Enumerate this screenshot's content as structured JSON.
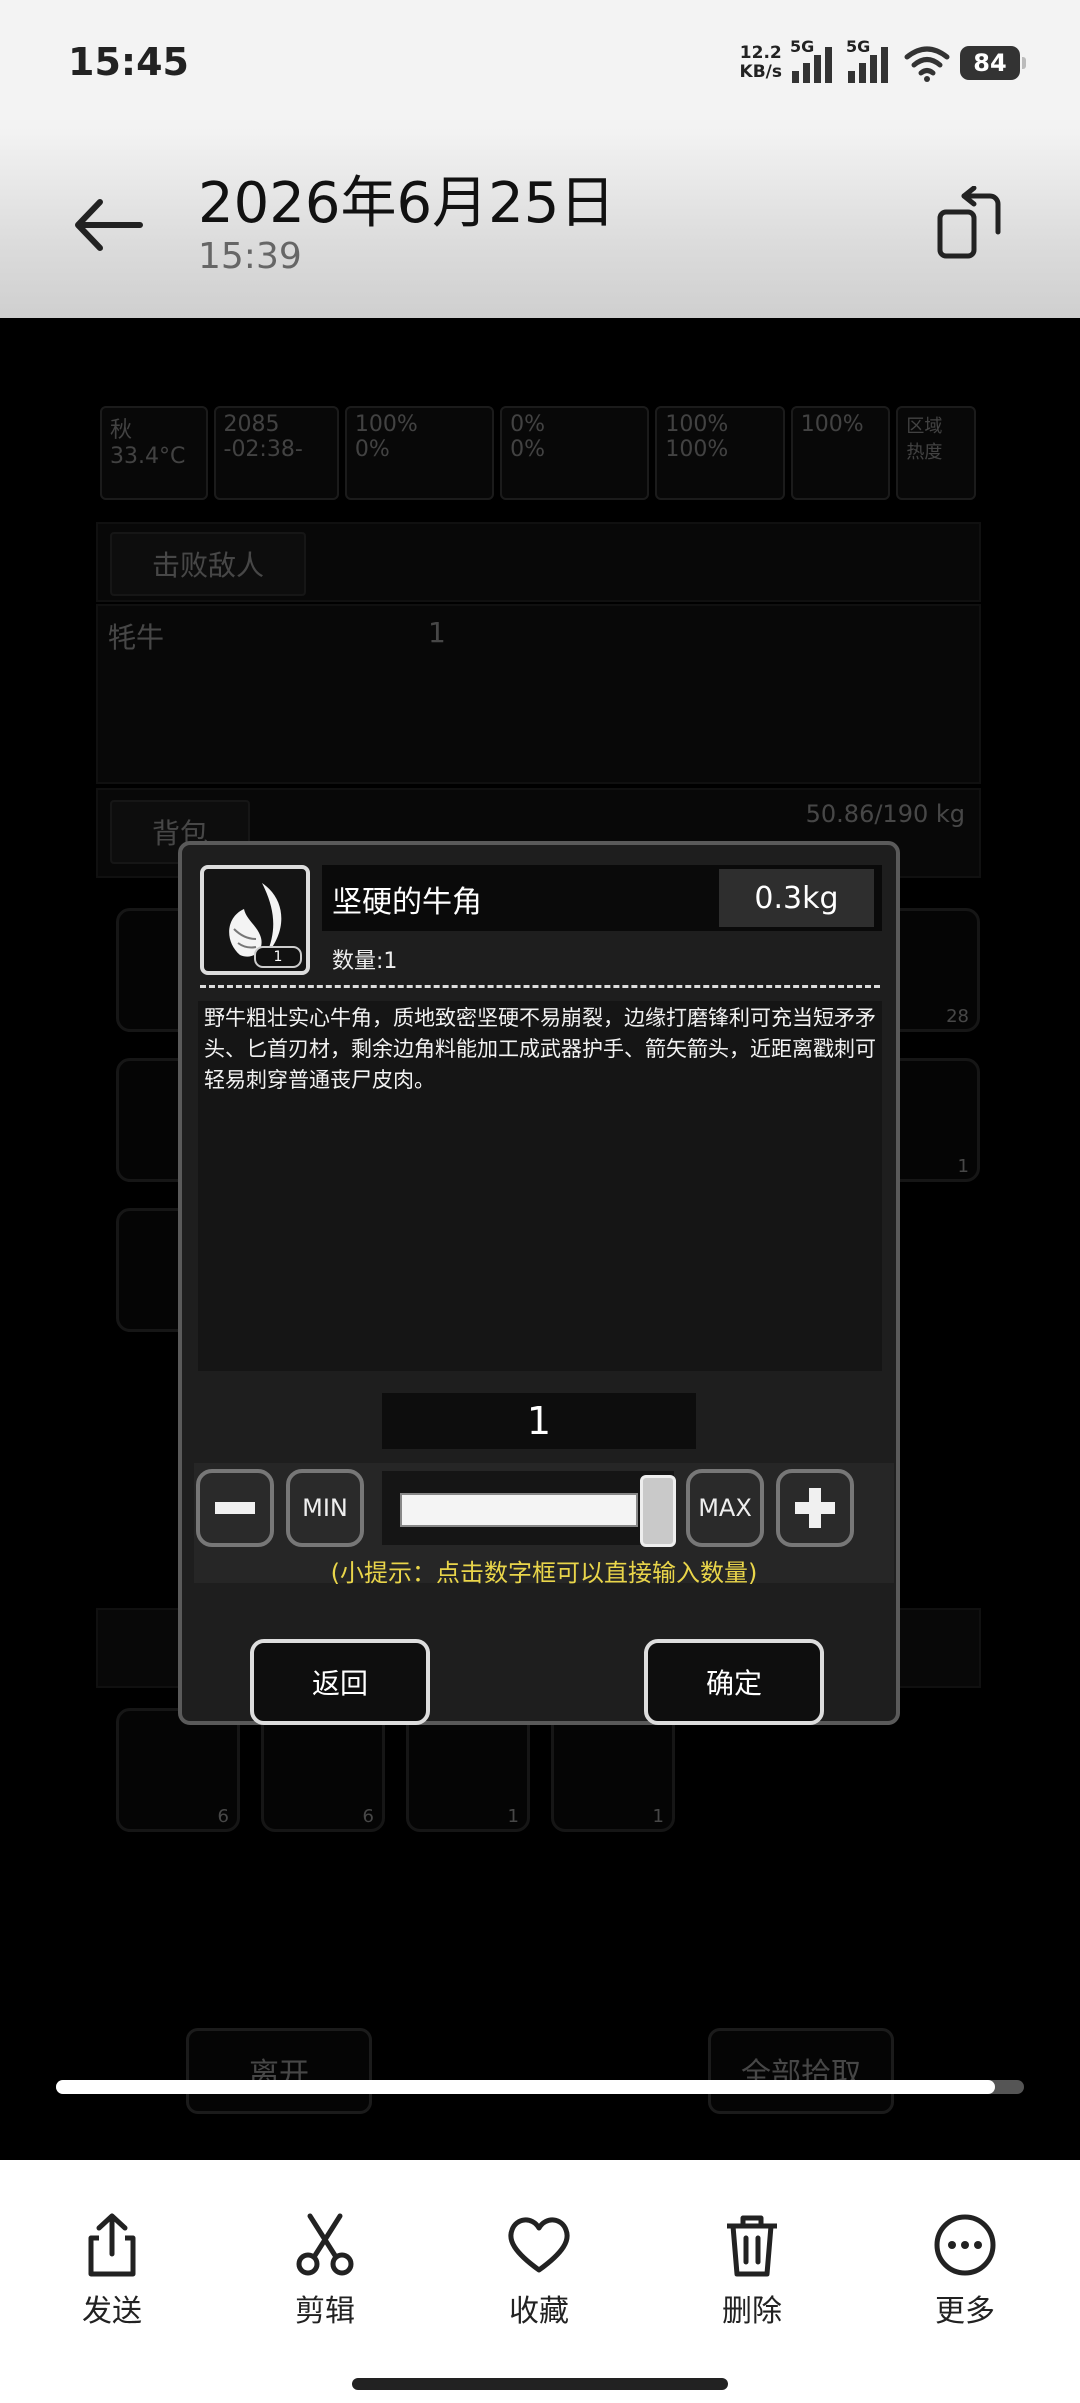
{
  "status_bar": {
    "time": "15:45",
    "net_speed_top": "12.2",
    "net_speed_bottom": "KB/s",
    "sig1": "5G",
    "sig2": "5G",
    "battery": "84"
  },
  "header": {
    "date": "2026年6月25日",
    "time": "15:39"
  },
  "game_bg": {
    "hud": [
      "秋",
      "33.4°C",
      "2085",
      "-02:38-",
      "100%",
      "0%",
      "0%",
      "0%",
      "100%",
      "100%",
      "100%",
      "区域 热度"
    ],
    "section_defeat": "击败敌人",
    "enemy_name": "牦牛",
    "enemy_count": "1",
    "section_bag": "背包",
    "bag_weight": "50.86/190 kg",
    "btn_leave": "离开",
    "btn_take_all": "全部拾取",
    "slot_counts": [
      "28",
      "1",
      "6",
      "6",
      "1",
      "1"
    ]
  },
  "dialog": {
    "item_name": "坚硬的牛角",
    "weight": "0.3kg",
    "icon_count": "1",
    "quantity_label": "数量:1",
    "description": "野牛粗壮实心牛角，质地致密坚硬不易崩裂，边缘打磨锋利可充当短矛矛头、匕首刃材，剩余边角料能加工成武器护手、箭矢箭头，近距离戳刺可轻易刺穿普通丧尸皮肉。",
    "quantity_value": "1",
    "min_label": "MIN",
    "max_label": "MAX",
    "hint": "(小提示：点击数字框可以直接输入数量)",
    "back_label": "返回",
    "confirm_label": "确定",
    "slider_fraction": 1.0
  },
  "player": {
    "progress_fraction": 0.97
  },
  "toolbar": [
    {
      "label": "发送",
      "icon": "share-icon"
    },
    {
      "label": "剪辑",
      "icon": "scissors-icon"
    },
    {
      "label": "收藏",
      "icon": "heart-icon"
    },
    {
      "label": "删除",
      "icon": "trash-icon"
    },
    {
      "label": "更多",
      "icon": "more-icon"
    }
  ]
}
